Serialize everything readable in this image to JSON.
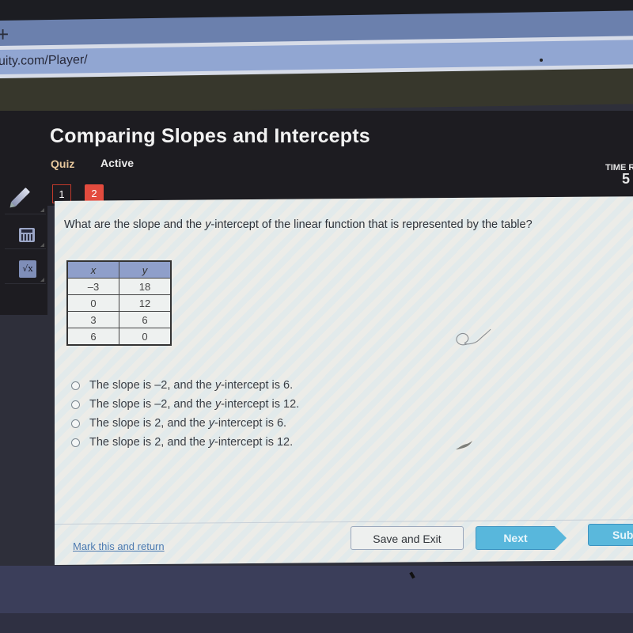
{
  "browser": {
    "new_tab_icon": "plus-icon",
    "url_fragment": "uity.com/Player/"
  },
  "header": {
    "title": "Comparing Slopes and Intercepts",
    "type_label": "Quiz",
    "status_label": "Active",
    "time_label": "TIME R",
    "time_value": "5"
  },
  "sidebar": {
    "tools": [
      {
        "name": "pencil",
        "icon": "pencil-icon"
      },
      {
        "name": "calculator",
        "icon": "calculator-icon"
      },
      {
        "name": "formula",
        "icon": "square-root-icon",
        "glyph": "√x"
      }
    ]
  },
  "question_nav": {
    "items": [
      {
        "label": "1",
        "current": false
      },
      {
        "label": "2",
        "current": true
      }
    ]
  },
  "question": {
    "text_before": "What are the slope and the ",
    "text_italic": "y",
    "text_after": "-intercept of the linear function that is represented by the table?",
    "table": {
      "headers": [
        "x",
        "y"
      ],
      "rows": [
        [
          "–3",
          "18"
        ],
        [
          "0",
          "12"
        ],
        [
          "3",
          "6"
        ],
        [
          "6",
          "0"
        ]
      ]
    },
    "options": [
      {
        "prefix": "The slope is –2, and the ",
        "italic": "y",
        "suffix": "-intercept is 6.",
        "selected": false
      },
      {
        "prefix": "The slope is –2, and the ",
        "italic": "y",
        "suffix": "-intercept is 12.",
        "selected": false
      },
      {
        "prefix": "The slope is 2, and the ",
        "italic": "y",
        "suffix": "-intercept is 6.",
        "selected": false
      },
      {
        "prefix": "The slope is 2, and the ",
        "italic": "y",
        "suffix": "-intercept is 12.",
        "selected": false
      }
    ]
  },
  "footer": {
    "mark_link": "Mark this and return",
    "save_exit": "Save and Exit",
    "next": "Next",
    "submit": "Submit"
  },
  "colors": {
    "accent_blue": "#58b7dc",
    "current_question_red": "#e34b3e",
    "quiz_label": "#e7c79c",
    "link_blue": "#4d7ab0"
  }
}
